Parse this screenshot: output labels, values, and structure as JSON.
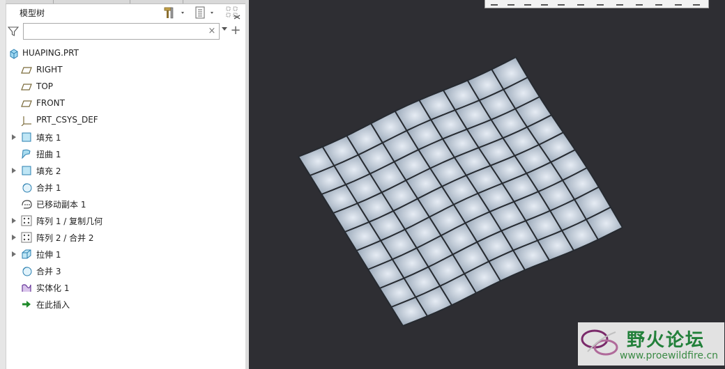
{
  "panel": {
    "title": "模型树",
    "search": {
      "value": "",
      "clear": "×"
    }
  },
  "tree": {
    "items": [
      {
        "label": "HUAPING.PRT",
        "icon": "part-icon",
        "expandable": false
      },
      {
        "label": "RIGHT",
        "icon": "datum-plane-icon",
        "expandable": false
      },
      {
        "label": "TOP",
        "icon": "datum-plane-icon",
        "expandable": false
      },
      {
        "label": "FRONT",
        "icon": "datum-plane-icon",
        "expandable": false
      },
      {
        "label": "PRT_CSYS_DEF",
        "icon": "csys-icon",
        "expandable": false
      },
      {
        "label": "填充 1",
        "icon": "fill-icon",
        "expandable": true
      },
      {
        "label": "扭曲 1",
        "icon": "warp-icon",
        "expandable": false
      },
      {
        "label": "填充 2",
        "icon": "fill-icon",
        "expandable": true
      },
      {
        "label": "合并 1",
        "icon": "merge-icon",
        "expandable": false
      },
      {
        "label": "已移动副本 1",
        "icon": "moved-copy-icon",
        "expandable": false
      },
      {
        "label": "阵列 1 / 复制几何",
        "icon": "pattern-icon",
        "expandable": true
      },
      {
        "label": "阵列 2 / 合并 2",
        "icon": "pattern-icon",
        "expandable": true
      },
      {
        "label": "拉伸 1",
        "icon": "extrude-icon",
        "expandable": true
      },
      {
        "label": "合并 3",
        "icon": "merge-icon",
        "expandable": false
      },
      {
        "label": "实体化 1",
        "icon": "solidify-icon",
        "expandable": false
      },
      {
        "label": "在此插入",
        "icon": "insert-here-icon",
        "expandable": false
      }
    ]
  },
  "watermark": {
    "title": "野火论坛",
    "url": "www.proewildfire.cn"
  },
  "colors": {
    "viewport_bg": "#2e2e33",
    "surface_light": "#dde5ef",
    "surface_dark": "#8796a8",
    "grid_line": "#262a30",
    "watermark_green": "#22803a"
  }
}
